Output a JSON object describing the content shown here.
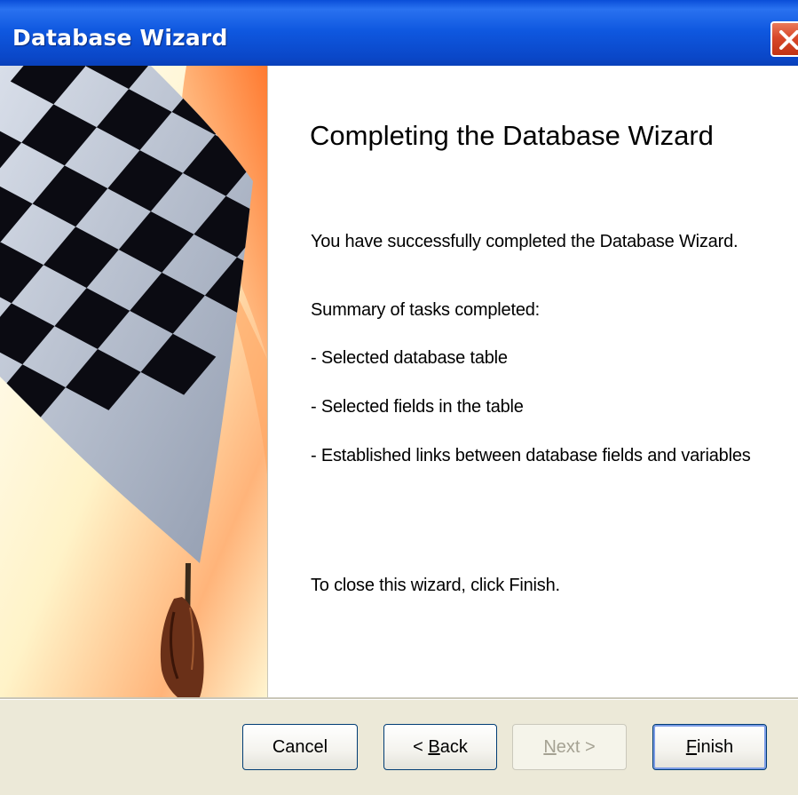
{
  "window": {
    "title": "Database Wizard"
  },
  "content": {
    "heading": "Completing the Database Wizard",
    "success_text": "You have successfully completed the Database Wizard.",
    "summary_label": "Summary of tasks completed:",
    "tasks": [
      "- Selected database table",
      "- Selected fields in the table",
      "- Established links between database fields and variables"
    ],
    "close_instruction": "To close this wizard, click Finish."
  },
  "buttons": {
    "cancel": "Cancel",
    "back_prefix": "< ",
    "back_mnemonic": "B",
    "back_rest": "ack",
    "next_mnemonic": "N",
    "next_rest": "ext >",
    "finish_mnemonic": "F",
    "finish_rest": "inish"
  },
  "colors": {
    "titlebar": "#0a4ed8",
    "close": "#d8482a",
    "panel": "#ffffff",
    "dialog": "#ece9d8"
  },
  "icons": {
    "close": "close-icon",
    "banner": "checkered-flag"
  }
}
